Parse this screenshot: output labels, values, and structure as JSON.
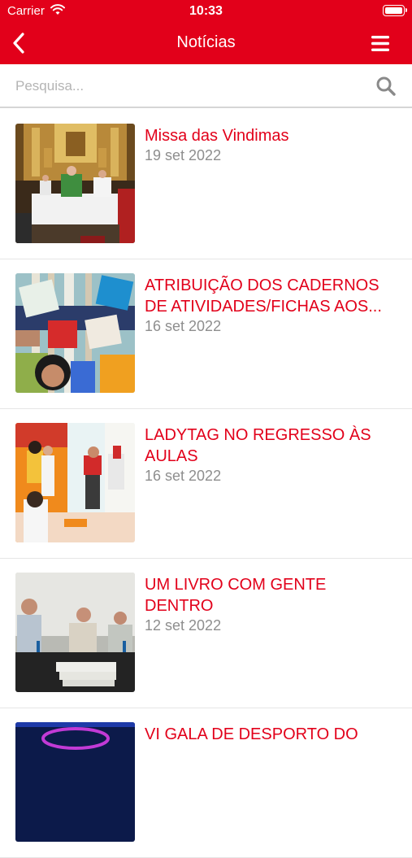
{
  "status_bar": {
    "carrier": "Carrier",
    "time": "10:33"
  },
  "nav": {
    "title": "Notícias",
    "back_icon": "chevron-left-icon",
    "menu_icon": "hamburger-menu-icon"
  },
  "search": {
    "placeholder": "Pesquisa...",
    "value": "",
    "icon": "search-icon"
  },
  "colors": {
    "brand": "#e2001a",
    "date": "#8e8e8e",
    "placeholder": "#b4b4b4"
  },
  "news": [
    {
      "title": "Missa das Vindimas",
      "date": "19 set 2022"
    },
    {
      "title": "ATRIBUIÇÃO DOS CADERNOS DE ATIVIDADES/FICHAS AOS...",
      "date": "16 set 2022"
    },
    {
      "title": "LADYTAG NO REGRESSO ÀS AULAS",
      "date": "16 set 2022"
    },
    {
      "title": "UM LIVRO COM GENTE DENTRO",
      "date": "12 set 2022"
    },
    {
      "title": "VI GALA DE DESPORTO DO",
      "date": ""
    }
  ]
}
